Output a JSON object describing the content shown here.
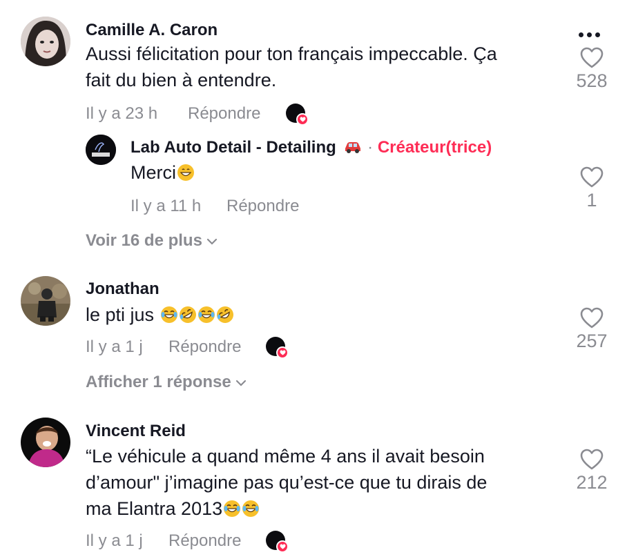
{
  "comments": [
    {
      "author": "Camille A. Caron",
      "text_line1": "Aussi félicitation pour ton français impeccable. Ça",
      "text_line2": "fait du bien à entendre.",
      "time": "Il y a 23 h",
      "reply_label": "Répondre",
      "likes": "528",
      "reply": {
        "author": "Lab Auto Detail - Detailing",
        "author_emoji": "car-icon",
        "separator": "·",
        "creator_tag": "Créateur(trice)",
        "text": "Merci",
        "text_emoji": "grinning-face-emoji",
        "time": "Il y a 11 h",
        "reply_label": "Répondre",
        "likes": "1"
      },
      "more_label": "Voir 16 de plus"
    },
    {
      "author": "Jonathan",
      "text": "le pti jus",
      "text_emojis": [
        "joy-emoji",
        "rofl-emoji",
        "joy-emoji",
        "rofl-emoji"
      ],
      "time": "Il y a 1 j",
      "reply_label": "Répondre",
      "likes": "257",
      "more_label": "Afficher 1 réponse"
    },
    {
      "author": "Vincent Reid",
      "text_line1": "“Le véhicule a quand même 4 ans il avait besoin",
      "text_line2": "d’amour\" j’imagine pas qu’est-ce que tu dirais de",
      "text_line3": "ma Elantra 2013",
      "text_emojis": [
        "joy-emoji",
        "joy-emoji"
      ],
      "time": "Il y a 1 j",
      "reply_label": "Répondre",
      "likes": "212"
    }
  ],
  "colors": {
    "accent": "#fe2c55",
    "muted": "#8a8b91",
    "text": "#161823"
  }
}
